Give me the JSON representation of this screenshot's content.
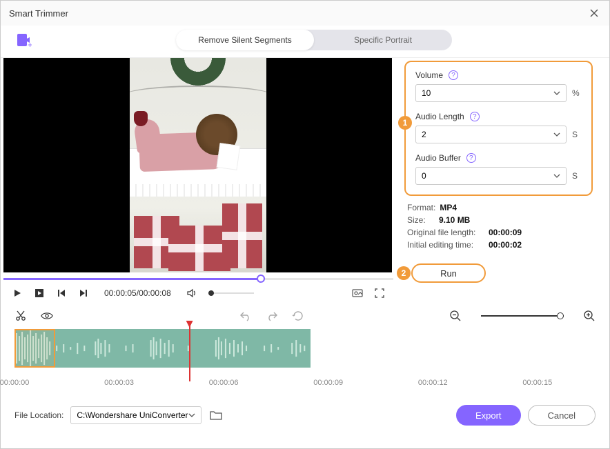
{
  "window": {
    "title": "Smart Trimmer"
  },
  "tabs": {
    "remove": "Remove Silent Segments",
    "portrait": "Specific Portrait"
  },
  "params": {
    "volume_label": "Volume",
    "volume_value": "10",
    "volume_unit": "%",
    "audio_length_label": "Audio Length",
    "audio_length_value": "2",
    "audio_length_unit": "S",
    "audio_buffer_label": "Audio Buffer",
    "audio_buffer_value": "0",
    "audio_buffer_unit": "S"
  },
  "info": {
    "format_label": "Format:",
    "format_value": "MP4",
    "size_label": "Size:",
    "size_value": "9.10 MB",
    "orig_len_label": "Original file length:",
    "orig_len_value": "00:00:09",
    "init_edit_label": "Initial editing time:",
    "init_edit_value": "00:00:02"
  },
  "run": {
    "label": "Run"
  },
  "playback": {
    "current": "00:00:05",
    "total": "00:00:08",
    "seek_percent": 66
  },
  "timeline": {
    "ticks": [
      "00:00:00",
      "00:00:03",
      "00:00:06",
      "00:00:09",
      "00:00:12",
      "00:00:15"
    ],
    "tick_positions": [
      0,
      18,
      36,
      54,
      72,
      90
    ],
    "clip_width_pct": 51,
    "selection_width_pct": 7,
    "playhead_pct": 30
  },
  "footer": {
    "location_label": "File Location:",
    "path": "C:\\Wondershare UniConverter",
    "export": "Export",
    "cancel": "Cancel"
  },
  "badges": {
    "one": "1",
    "two": "2"
  }
}
